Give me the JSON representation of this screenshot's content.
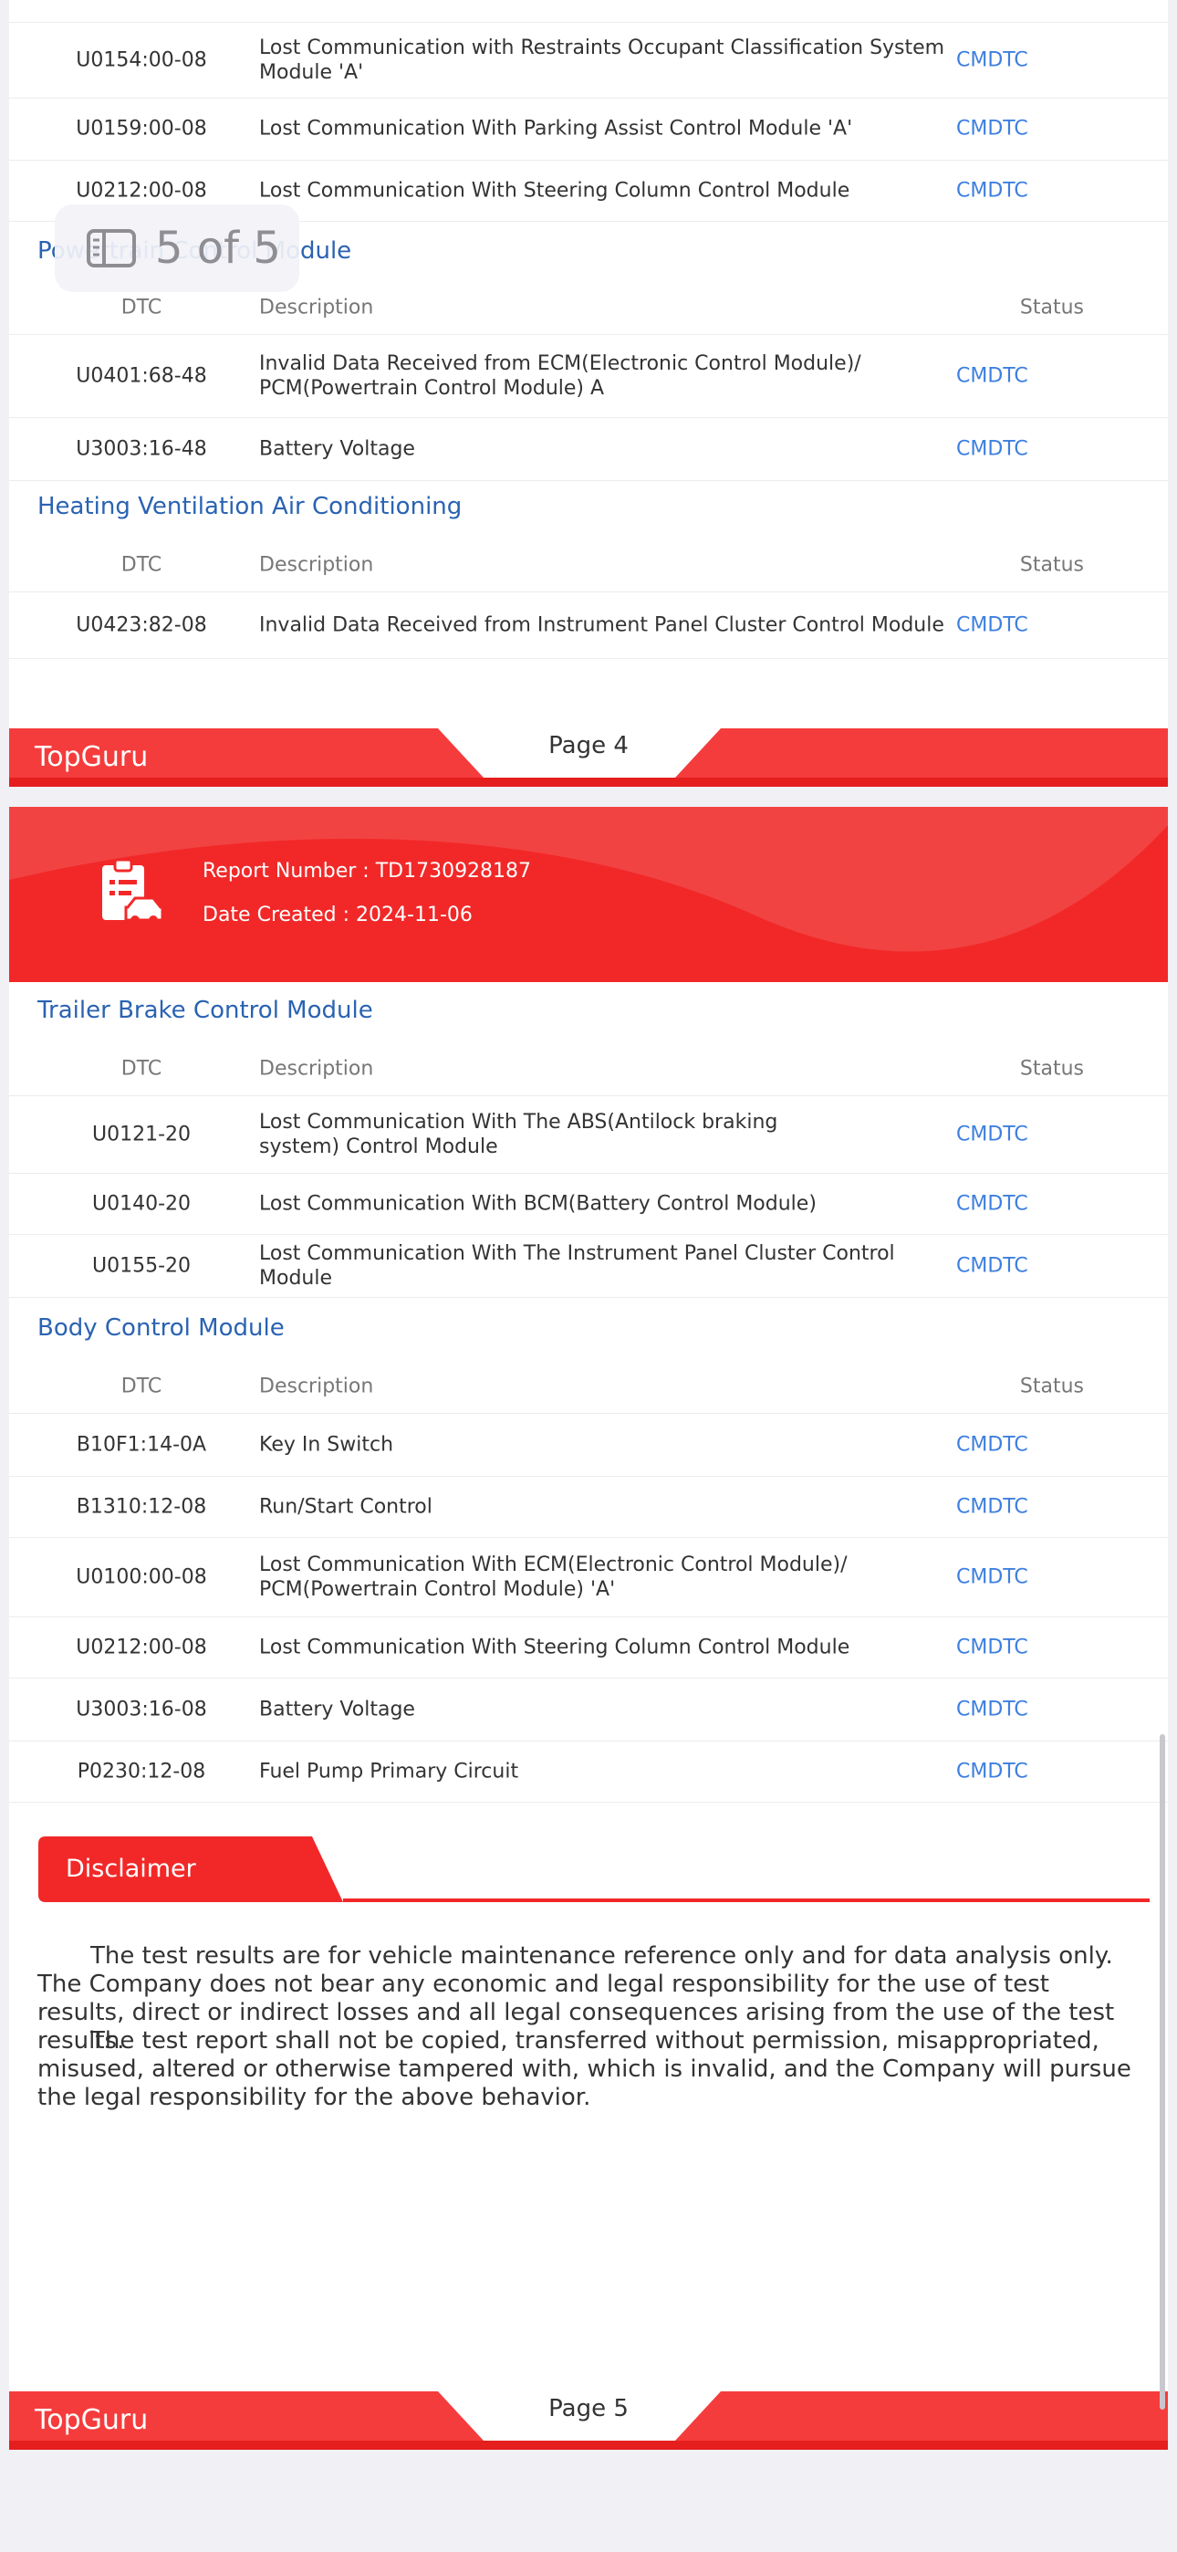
{
  "overlay": {
    "counter": "5 of 5"
  },
  "page4": {
    "top_rows": [
      {
        "dtc": "U0154:00-08",
        "description": "Lost Communication with Restraints Occupant Classification System Module 'A'",
        "status": "CMDTC"
      },
      {
        "dtc": "U0159:00-08",
        "description": "Lost Communication With Parking Assist Control Module 'A'",
        "status": "CMDTC"
      },
      {
        "dtc": "U0212:00-08",
        "description": "Lost Communication With Steering Column Control Module",
        "status": "CMDTC"
      }
    ],
    "pcm_section": {
      "title": "Powertrain Control Module",
      "rows": [
        {
          "dtc": "U0401:68-48",
          "description": "Invalid Data Received from ECM(Electronic Control Module)/ PCM(Powertrain Control Module) A",
          "status": "CMDTC"
        },
        {
          "dtc": "U3003:16-48",
          "description": "Battery Voltage",
          "status": "CMDTC"
        }
      ]
    },
    "hvac_section": {
      "title": "Heating Ventilation Air Conditioning",
      "rows": [
        {
          "dtc": "U0423:82-08",
          "description": "Invalid Data Received from Instrument Panel Cluster Control Module",
          "status": "CMDTC"
        }
      ]
    },
    "footer": {
      "brand": "TopGuru",
      "page": "Page 4"
    }
  },
  "headers": {
    "dtc": "DTC",
    "description": "Description",
    "status": "Status"
  },
  "page5": {
    "report_number": "Report Number : TD1730928187",
    "date_created": "Date Created : 2024-11-06",
    "trailer_section": {
      "title": "Trailer Brake Control Module",
      "rows": [
        {
          "dtc": "U0121-20",
          "description": "Lost Communication With The ABS(Antilock braking system) Control Module",
          "status": "CMDTC"
        },
        {
          "dtc": "U0140-20",
          "description": "Lost Communication With BCM(Battery Control Module)",
          "status": "CMDTC"
        },
        {
          "dtc": "U0155-20",
          "description": "Lost Communication With The Instrument Panel Cluster Control Module",
          "status": "CMDTC"
        }
      ]
    },
    "body_section": {
      "title": "Body Control Module",
      "rows": [
        {
          "dtc": "B10F1:14-0A",
          "description": "Key In Switch",
          "status": "CMDTC"
        },
        {
          "dtc": "B1310:12-08",
          "description": "Run/Start Control",
          "status": "CMDTC"
        },
        {
          "dtc": "U0100:00-08",
          "description": "Lost Communication With ECM(Electronic Control Module)/ PCM(Powertrain Control Module) 'A'",
          "status": "CMDTC"
        },
        {
          "dtc": "U0212:00-08",
          "description": "Lost Communication With Steering Column Control Module",
          "status": "CMDTC"
        },
        {
          "dtc": "U3003:16-08",
          "description": "Battery Voltage",
          "status": "CMDTC"
        },
        {
          "dtc": "P0230:12-08",
          "description": "Fuel Pump Primary Circuit",
          "status": "CMDTC"
        }
      ]
    },
    "disclaimer": {
      "title": "Disclaimer",
      "paragraph1": "The test results are for vehicle maintenance reference only and for data analysis only. The Company does not bear any economic and legal responsibility for the use of test results, direct or indirect losses and all legal consequences arising from the use of the test results.",
      "paragraph2": "The test report shall not be copied, transferred without permission, misappropriated, misused, altered or otherwise tampered with, which is invalid, and the Company will pursue the legal responsibility for the above behavior."
    },
    "footer": {
      "brand": "TopGuru",
      "page": "Page 5"
    }
  },
  "colors": {
    "accent_red": "#f22828",
    "link_blue": "#3d7fe0",
    "title_blue": "#2a63b2"
  }
}
